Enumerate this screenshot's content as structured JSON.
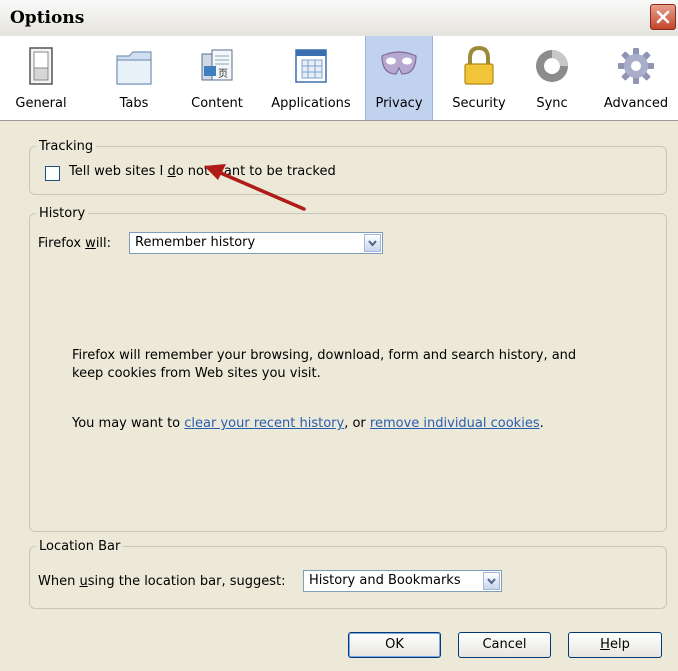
{
  "window": {
    "title": "Options"
  },
  "toolbar": {
    "items": [
      {
        "label": "General",
        "icon": "general-switch-icon"
      },
      {
        "label": "Tabs",
        "icon": "tabs-folder-icon"
      },
      {
        "label": "Content",
        "icon": "content-page-icon"
      },
      {
        "label": "Applications",
        "icon": "applications-window-icon"
      },
      {
        "label": "Privacy",
        "icon": "privacy-mask-icon",
        "active": true
      },
      {
        "label": "Security",
        "icon": "security-lock-icon"
      },
      {
        "label": "Sync",
        "icon": "sync-icon"
      },
      {
        "label": "Advanced",
        "icon": "advanced-gear-icon"
      }
    ]
  },
  "tracking": {
    "legend": "Tracking",
    "checkbox_label_pre": "Tell web sites I ",
    "checkbox_label_ul": "d",
    "checkbox_label_post": "o not want to be tracked",
    "checked": false
  },
  "history": {
    "legend": "History",
    "firefox_will_label_pre": "Firefox ",
    "firefox_will_label_ul": "w",
    "firefox_will_label_post": "ill:",
    "select_value": "Remember history",
    "desc_line1": "Firefox will remember your browsing, download, form and search history, and",
    "desc_line2": "keep cookies from Web sites you visit.",
    "may_want_pre": "You may want to ",
    "link_clear": "clear your recent history",
    "may_want_mid": ", or ",
    "link_remove": "remove individual cookies",
    "may_want_post": "."
  },
  "location": {
    "legend": "Location Bar",
    "suggest_label_pre": "When ",
    "suggest_label_ul": "u",
    "suggest_label_post": "sing the location bar, suggest:",
    "select_value": "History and Bookmarks"
  },
  "buttons": {
    "ok": "OK",
    "cancel": "Cancel",
    "help_ul": "H",
    "help_rest": "elp"
  },
  "colors": {
    "arrow": "#b01c17",
    "active_tab": "#c1d2ee",
    "link": "#2a5db0",
    "close": "#c5432c"
  }
}
